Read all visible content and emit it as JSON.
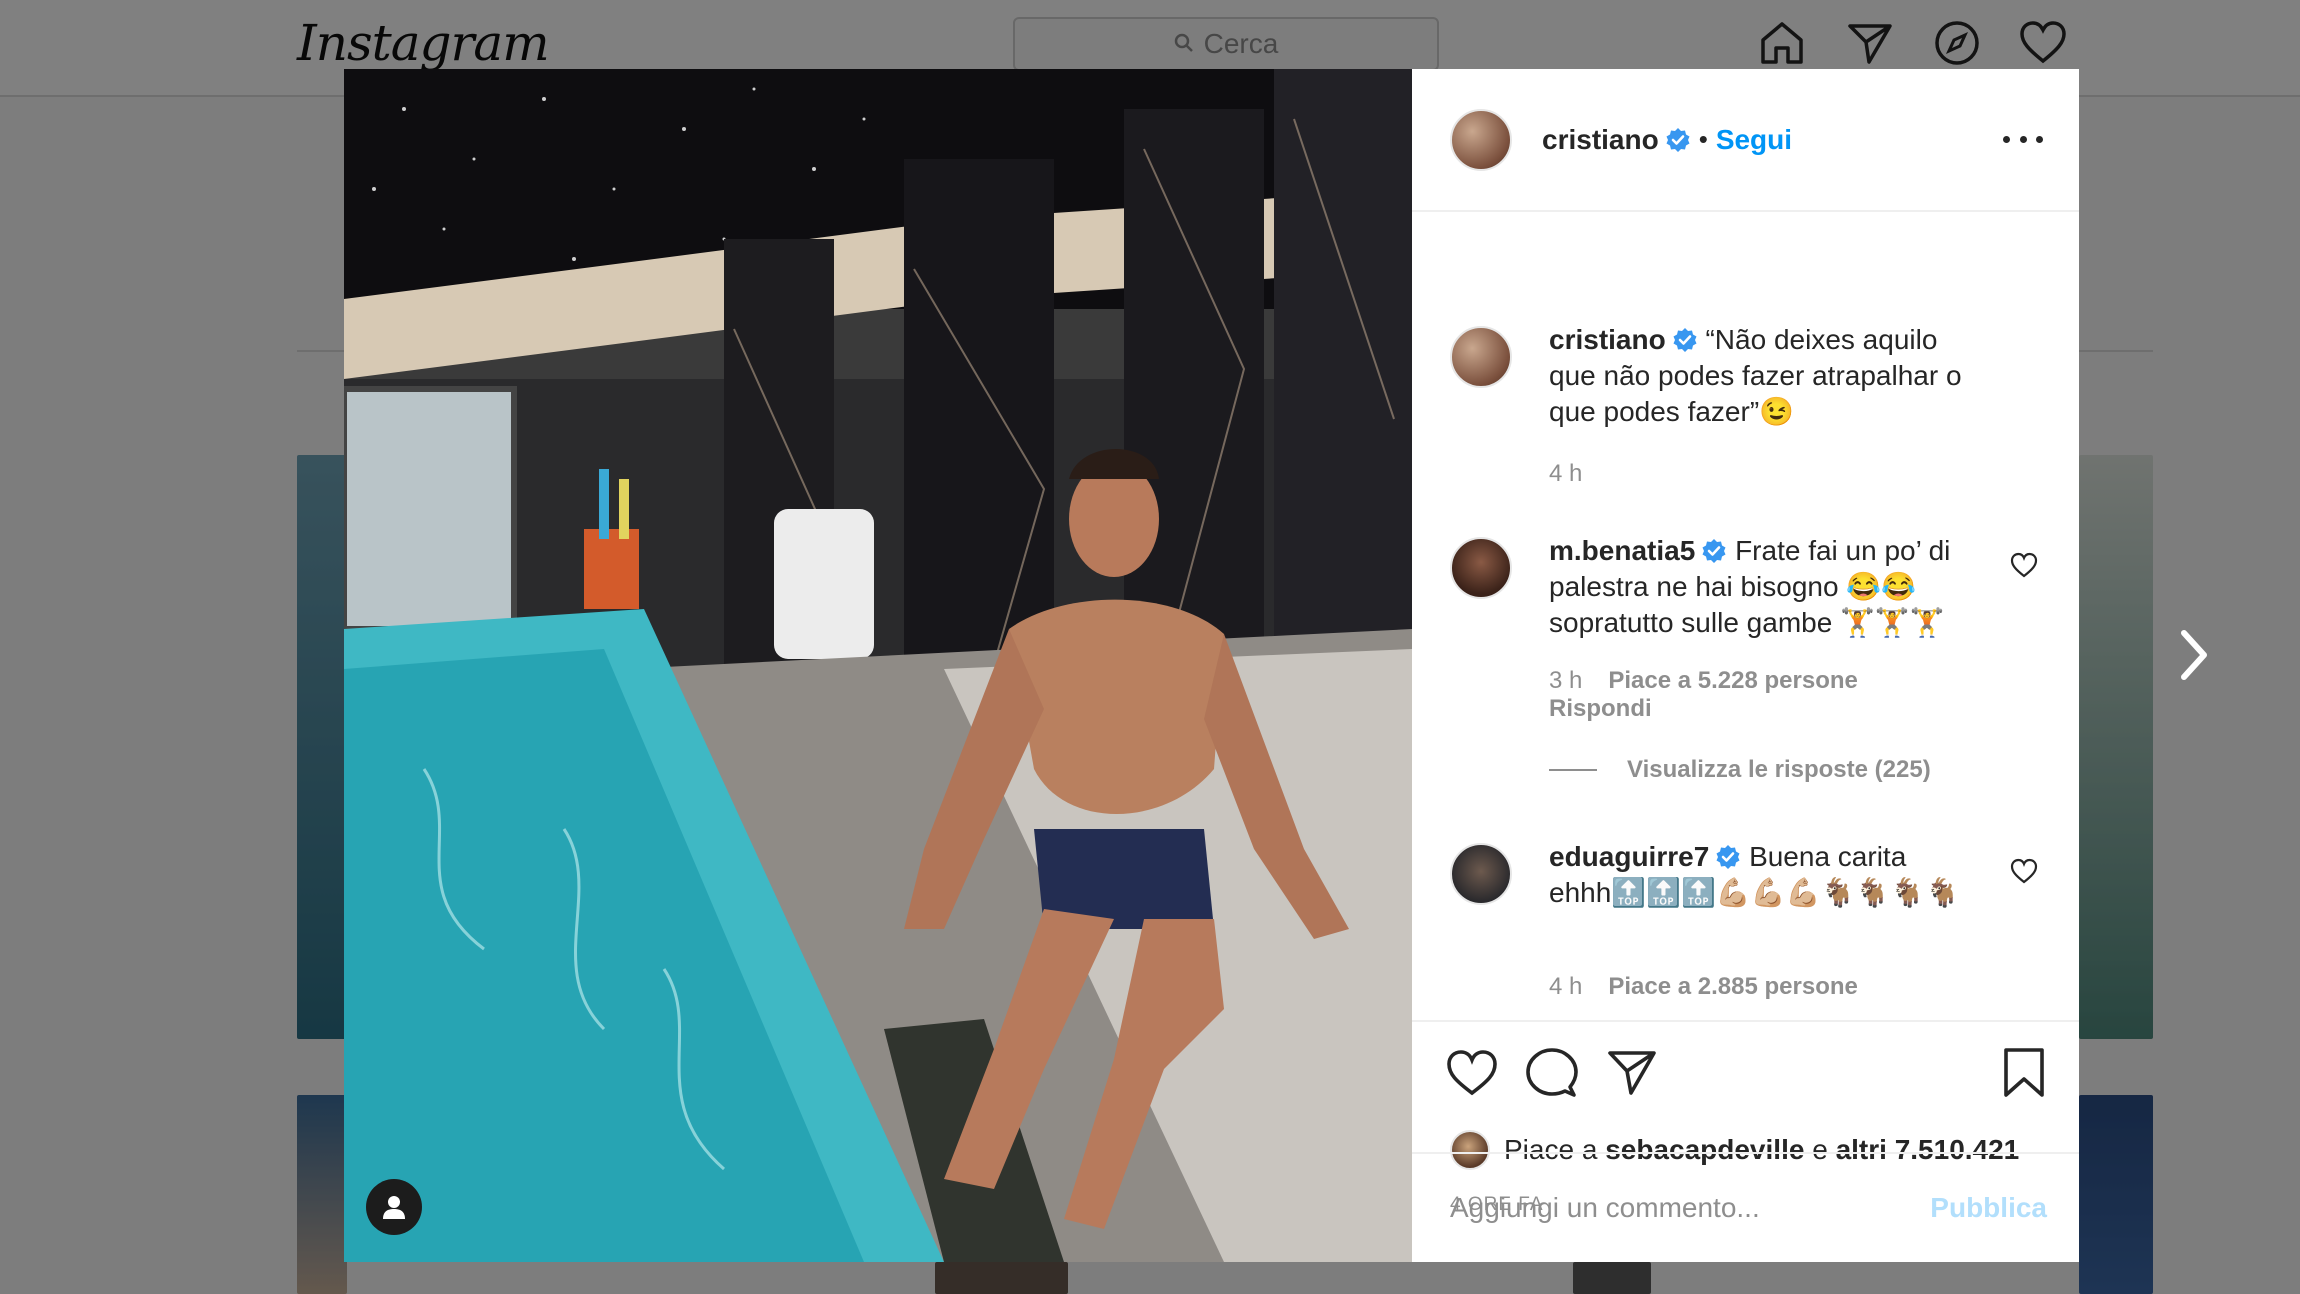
{
  "app": {
    "logo": "Instagram"
  },
  "search": {
    "placeholder": "Cerca"
  },
  "nav_icons": [
    "home-icon",
    "direct-icon",
    "explore-icon",
    "activity-heart-icon"
  ],
  "post": {
    "username": "cristiano",
    "follow_label": "Segui",
    "separator": "•",
    "caption_text": "“Não deixes aquilo que não podes fazer atrapalhar o que podes fazer”😉",
    "caption_time": "4 h",
    "comments": [
      {
        "username": "m.benatia5",
        "text": "Frate fai un po’ di palestra ne hai bisogno 😂😂 sopratutto sulle gambe 🏋🏋🏋",
        "time": "3 h",
        "likes": "Piace a 5.228 persone",
        "reply": "Rispondi",
        "view_replies": "Visualizza le risposte (225)"
      },
      {
        "username": "eduaguirre7",
        "text": "Buena carita ehhh🔝🔝🔝💪🏼💪🏼💪🏼🐐🐐🐐🐐",
        "time": "4 h",
        "likes": "Piace a 2.885 persone"
      }
    ],
    "liked_by_prefix": "Piace a",
    "liked_by_user": "sebacapdeville",
    "liked_by_conj": "e",
    "liked_by_others": "altri 7.510.421",
    "time_ago": "4 ORE FA",
    "comment_placeholder": "Aggiungi un commento...",
    "publish_label": "Pubblica"
  },
  "colors": {
    "accent": "#0095f6",
    "publish_disabled": "#b2dffc",
    "muted": "#8e8e8e",
    "verified": "#3897f0"
  }
}
